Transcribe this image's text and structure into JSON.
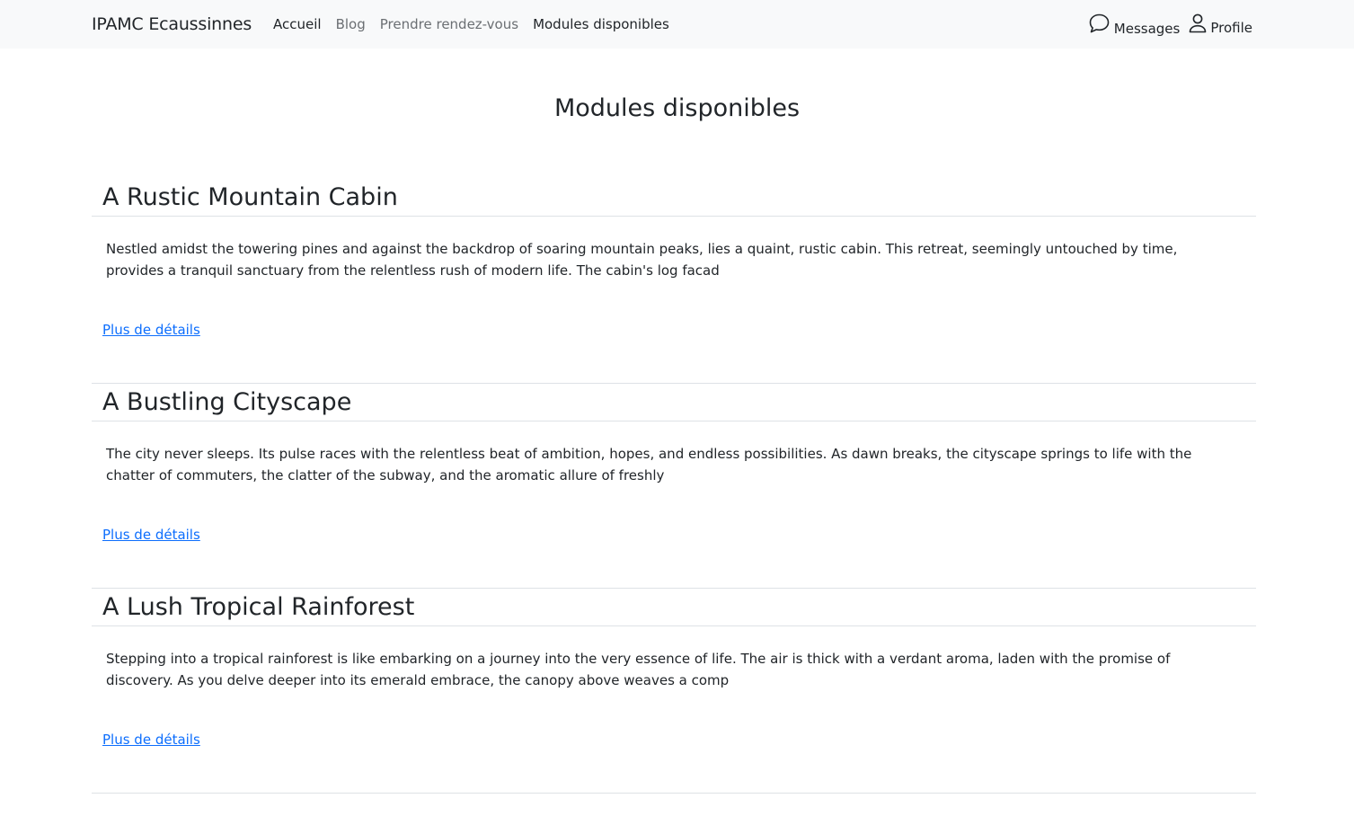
{
  "navbar": {
    "brand": "IPAMC Ecaussinnes",
    "links": [
      {
        "label": "Accueil"
      },
      {
        "label": "Blog"
      },
      {
        "label": "Prendre rendez-vous"
      },
      {
        "label": "Modules disponibles"
      }
    ],
    "right": {
      "messages_label": "Messages",
      "messages_icon": "chat-bubble-icon",
      "profile_label": "Profile",
      "profile_icon": "person-icon"
    }
  },
  "page": {
    "title": "Modules disponibles"
  },
  "modules": [
    {
      "title": "A Rustic Mountain Cabin",
      "description": "Nestled amidst the towering pines and against the backdrop of soaring mountain peaks, lies a quaint, rustic cabin. This retreat, seemingly untouched by time, provides a tranquil sanctuary from the relentless rush of modern life. The cabin's log facad",
      "link": "Plus de détails"
    },
    {
      "title": "A Bustling Cityscape",
      "description": "The city never sleeps. Its pulse races with the relentless beat of ambition, hopes, and endless possibilities. As dawn breaks, the cityscape springs to life with the chatter of commuters, the clatter of the subway, and the aromatic allure of freshly",
      "link": "Plus de détails"
    },
    {
      "title": "A Lush Tropical Rainforest",
      "description": "Stepping into a tropical rainforest is like embarking on a journey into the very essence of life. The air is thick with a verdant aroma, laden with the promise of discovery. As you delve deeper into its emerald embrace, the canopy above weaves a comp",
      "link": "Plus de détails"
    }
  ],
  "colors": {
    "navbar_bg": "#f8f9fa",
    "link": "#0d6efd",
    "text": "#212529",
    "muted": "#6b6f73"
  }
}
